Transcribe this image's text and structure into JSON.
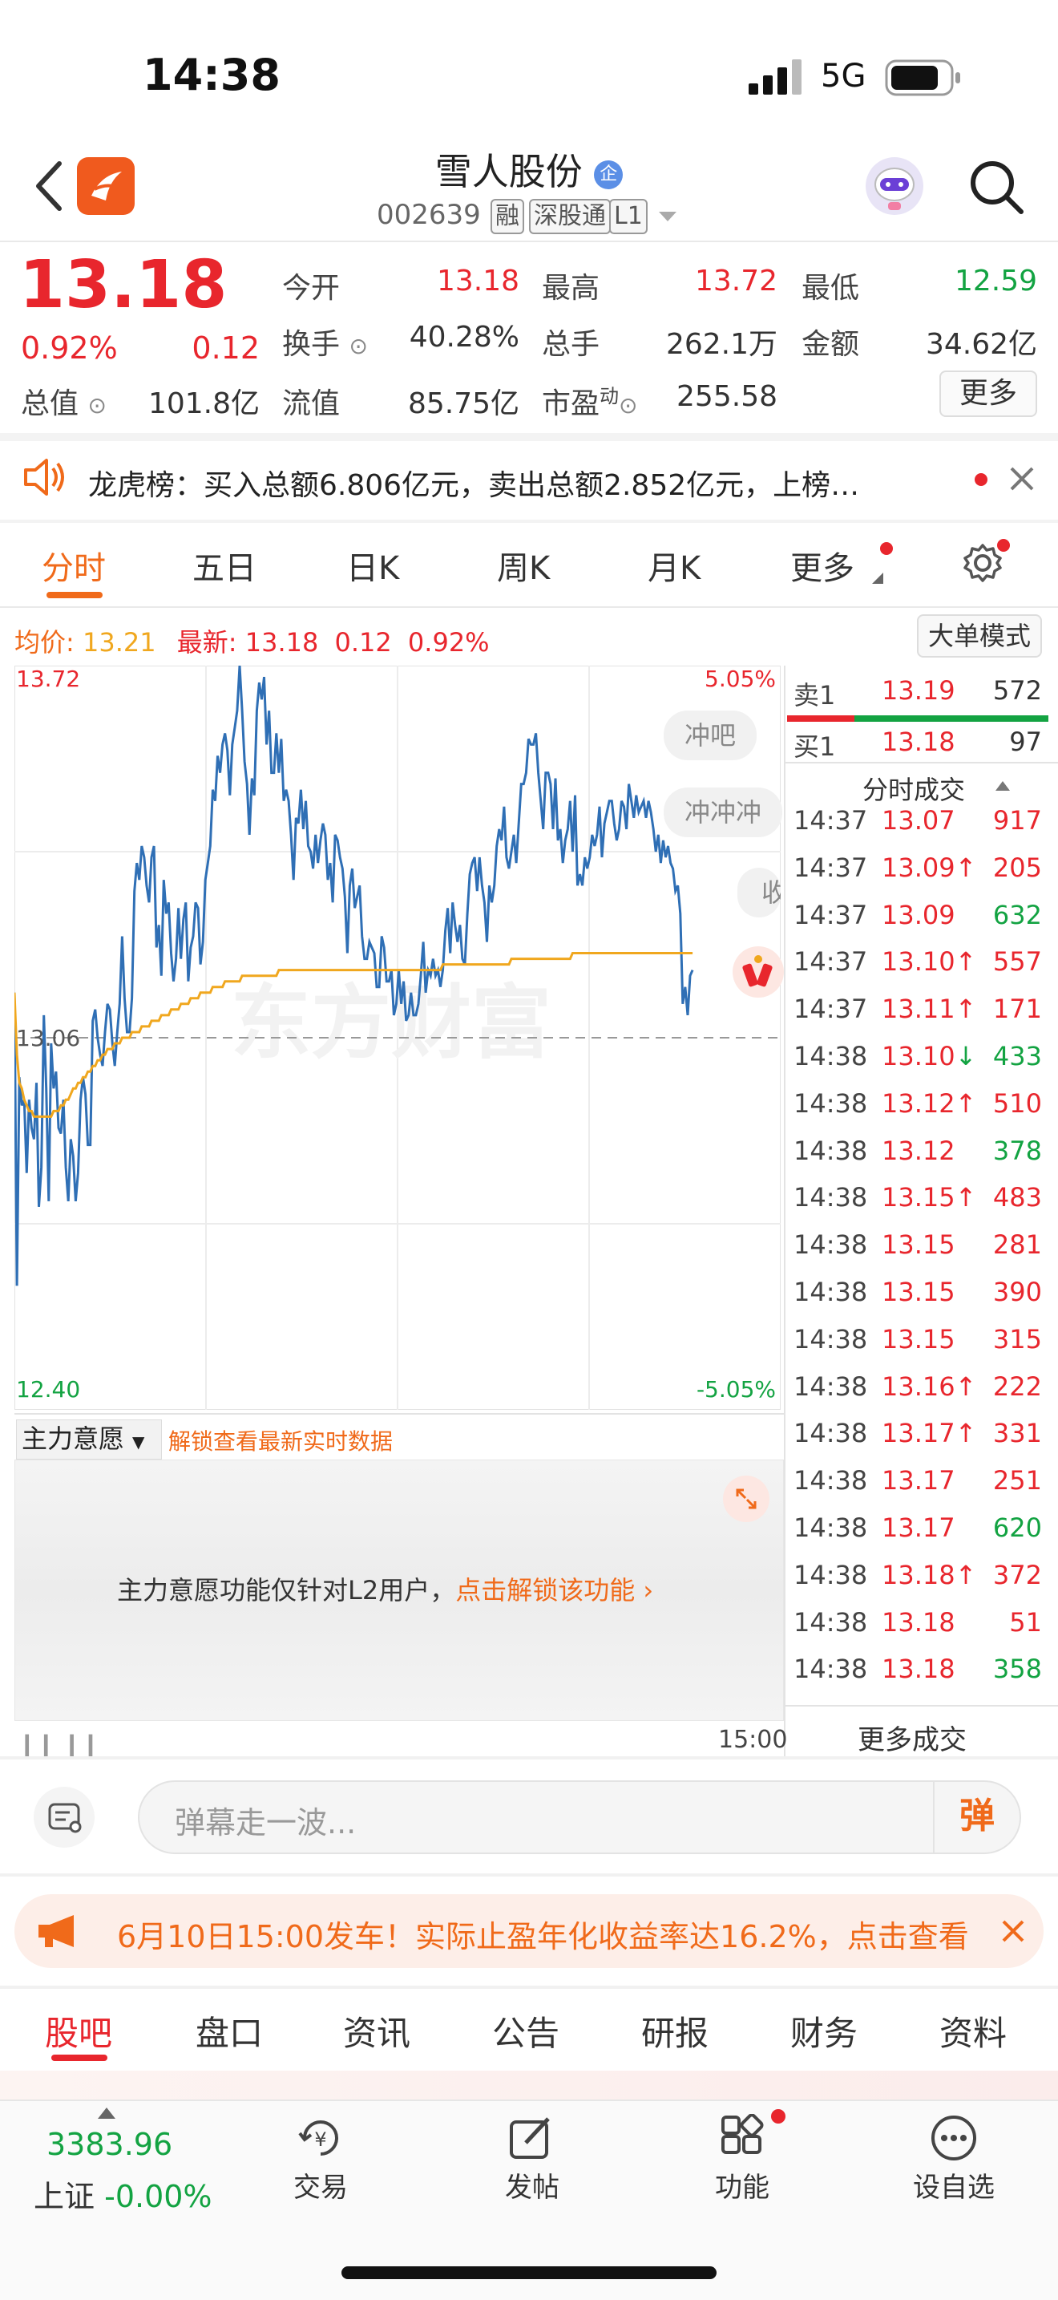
{
  "status": {
    "time": "14:38",
    "network": "5G"
  },
  "header": {
    "title": "雪人股份",
    "badge": "企",
    "code": "002639",
    "tags": [
      "融",
      "深股通",
      "L1"
    ]
  },
  "quote": {
    "price": "13.18",
    "change_pct": "0.92%",
    "change": "0.12",
    "open_label": "今开",
    "open": "13.18",
    "high_label": "最高",
    "high": "13.72",
    "low_label": "最低",
    "low": "12.59",
    "turnover_label": "换手",
    "turnover": "40.28%",
    "volume_label": "总手",
    "volume": "262.1万",
    "amount_label": "金额",
    "amount": "34.62亿",
    "mktcap_label": "总值",
    "mktcap": "101.8亿",
    "float_label": "流值",
    "float": "85.75亿",
    "pe_label": "市盈",
    "pe_sup": "动",
    "pe": "255.58",
    "more_button": "更多"
  },
  "notice": {
    "text": "龙虎榜：买入总额6.806亿元，卖出总额2.852亿元，上榜…"
  },
  "tabs": [
    "分时",
    "五日",
    "日K",
    "周K",
    "月K",
    "更多"
  ],
  "chart_info": {
    "avg_label": "均价:",
    "avg": "13.21",
    "latest_label": "最新:",
    "latest": "13.18",
    "latest_change": "0.12",
    "latest_pct": "0.92%",
    "mode_button": "大单模式",
    "y_max": "13.72",
    "y_mid": "13.06",
    "y_min": "12.40",
    "pct_max": "5.05%",
    "pct_min": "-5.05%",
    "end_time": "15:00",
    "bullet1": "冲吧",
    "bullet2": "冲冲冲",
    "bullet3": "收",
    "watermark": "东方财富"
  },
  "chart_data": {
    "type": "line",
    "y_range": [
      12.4,
      13.72
    ],
    "series": [
      {
        "name": "最新",
        "color": "#2f6fb5",
        "values": [
          13.14,
          12.62,
          12.99,
          12.94,
          12.95,
          12.82,
          12.95,
          12.9,
          12.88,
          12.98,
          12.76,
          12.83,
          13.1,
          12.97,
          12.77,
          13.05,
          12.97,
          13.0,
          12.9,
          12.89,
          12.95,
          12.83,
          12.77,
          12.88,
          12.85,
          12.77,
          12.82,
          12.95,
          12.99,
          12.96,
          12.87,
          12.87,
          13.09,
          13.11,
          13.06,
          13.03,
          13.01,
          13.07,
          13.12,
          13.11,
          13.05,
          13.01,
          13.07,
          13.12,
          13.24,
          13.13,
          13.07,
          13.07,
          13.13,
          13.32,
          13.37,
          13.34,
          13.4,
          13.38,
          13.33,
          13.3,
          13.38,
          13.4,
          13.22,
          13.26,
          13.17,
          13.34,
          13.28,
          13.3,
          13.21,
          13.16,
          13.2,
          13.29,
          13.2,
          13.27,
          13.3,
          13.16,
          13.22,
          13.24,
          13.3,
          13.29,
          13.19,
          13.23,
          13.34,
          13.37,
          13.4,
          13.5,
          13.48,
          13.56,
          13.53,
          13.58,
          13.6,
          13.57,
          13.49,
          13.58,
          13.61,
          13.64,
          13.72,
          13.64,
          13.55,
          13.51,
          13.42,
          13.52,
          13.49,
          13.64,
          13.69,
          13.66,
          13.7,
          13.58,
          13.64,
          13.53,
          13.53,
          13.6,
          13.53,
          13.59,
          13.48,
          13.5,
          13.48,
          13.42,
          13.34,
          13.45,
          13.44,
          13.5,
          13.43,
          13.48,
          13.4,
          13.39,
          13.36,
          13.42,
          13.37,
          13.41,
          13.44,
          13.42,
          13.34,
          13.37,
          13.3,
          13.42,
          13.41,
          13.38,
          13.36,
          13.31,
          13.21,
          13.33,
          13.36,
          13.29,
          13.31,
          13.33,
          13.24,
          13.2,
          13.2,
          13.23,
          13.22,
          13.21,
          13.15,
          13.15,
          13.24,
          13.22,
          13.16,
          13.16,
          13.18,
          13.1,
          13.12,
          13.18,
          13.12,
          13.16,
          13.09,
          13.1,
          13.14,
          13.1,
          13.1,
          13.12,
          13.17,
          13.23,
          13.14,
          13.18,
          13.17,
          13.2,
          13.17,
          13.18,
          13.15,
          13.18,
          13.25,
          13.29,
          13.21,
          13.3,
          13.26,
          13.23,
          13.26,
          13.2,
          13.19,
          13.28,
          13.35,
          13.37,
          13.38,
          13.32,
          13.38,
          13.33,
          13.3,
          13.23,
          13.33,
          13.3,
          13.33,
          13.4,
          13.43,
          13.41,
          13.47,
          13.38,
          13.36,
          13.39,
          13.42,
          13.37,
          13.44,
          13.51,
          13.51,
          13.53,
          13.59,
          13.58,
          13.58,
          13.6,
          13.53,
          13.48,
          13.43,
          13.53,
          13.53,
          13.51,
          13.43,
          13.52,
          13.41,
          13.43,
          13.37,
          13.41,
          13.43,
          13.48,
          13.39,
          13.49,
          13.33,
          13.35,
          13.33,
          13.38,
          13.36,
          13.38,
          13.42,
          13.4,
          13.42,
          13.47,
          13.38,
          13.44,
          13.46,
          13.48,
          13.48,
          13.44,
          13.41,
          13.43,
          13.48,
          13.47,
          13.43,
          13.51,
          13.48,
          13.45,
          13.49,
          13.46,
          13.47,
          13.48,
          13.45,
          13.48,
          13.46,
          13.43,
          13.39,
          13.42,
          13.37,
          13.41,
          13.38,
          13.4,
          13.37,
          13.36,
          13.32,
          13.33,
          13.28,
          13.12,
          13.15,
          13.1,
          13.17,
          13.18
        ]
      },
      {
        "name": "均价",
        "color": "#f0a71e",
        "values": [
          13.14,
          13.03,
          12.98,
          12.97,
          12.95,
          12.94,
          12.93,
          12.93,
          12.92,
          12.92,
          12.92,
          12.92,
          12.92,
          12.92,
          12.92,
          12.92,
          12.93,
          12.93,
          12.93,
          12.94,
          12.94,
          12.95,
          12.95,
          12.96,
          12.97,
          12.97,
          12.98,
          12.98,
          12.99,
          12.99,
          13.0,
          13.0,
          13.01,
          13.01,
          13.02,
          13.02,
          13.03,
          13.03,
          13.04,
          13.04,
          13.04,
          13.05,
          13.05,
          13.05,
          13.06,
          13.06,
          13.06,
          13.06,
          13.07,
          13.07,
          13.07,
          13.07,
          13.08,
          13.08,
          13.08,
          13.08,
          13.09,
          13.09,
          13.09,
          13.09,
          13.1,
          13.1,
          13.1,
          13.1,
          13.11,
          13.11,
          13.11,
          13.11,
          13.12,
          13.12,
          13.12,
          13.12,
          13.13,
          13.13,
          13.13,
          13.13,
          13.14,
          13.14,
          13.14,
          13.14,
          13.14,
          13.15,
          13.15,
          13.15,
          13.15,
          13.15,
          13.16,
          13.16,
          13.16,
          13.16,
          13.16,
          13.16,
          13.16,
          13.17,
          13.17,
          13.17,
          13.17,
          13.17,
          13.17,
          13.17,
          13.17,
          13.17,
          13.17,
          13.17,
          13.17,
          13.17,
          13.17,
          13.17,
          13.18,
          13.18,
          13.18,
          13.18,
          13.18,
          13.18,
          13.18,
          13.18,
          13.18,
          13.18,
          13.18,
          13.18,
          13.18,
          13.18,
          13.18,
          13.18,
          13.18,
          13.18,
          13.18,
          13.18,
          13.18,
          13.18,
          13.18,
          13.18,
          13.18,
          13.18,
          13.18,
          13.18,
          13.18,
          13.18,
          13.18,
          13.18,
          13.18,
          13.18,
          13.18,
          13.18,
          13.18,
          13.18,
          13.18,
          13.18,
          13.18,
          13.18,
          13.18,
          13.18,
          13.18,
          13.18,
          13.18,
          13.18,
          13.18,
          13.18,
          13.18,
          13.18,
          13.18,
          13.18,
          13.18,
          13.18,
          13.18,
          13.18,
          13.18,
          13.18,
          13.18,
          13.18,
          13.18,
          13.18,
          13.18,
          13.18,
          13.18,
          13.19,
          13.19,
          13.19,
          13.19,
          13.19,
          13.19,
          13.19,
          13.19,
          13.19,
          13.19,
          13.19,
          13.19,
          13.19,
          13.19,
          13.19,
          13.19,
          13.19,
          13.19,
          13.19,
          13.19,
          13.19,
          13.19,
          13.19,
          13.19,
          13.19,
          13.19,
          13.19,
          13.19,
          13.2,
          13.2,
          13.2,
          13.2,
          13.2,
          13.2,
          13.2,
          13.2,
          13.2,
          13.2,
          13.2,
          13.2,
          13.2,
          13.2,
          13.2,
          13.2,
          13.2,
          13.2,
          13.2,
          13.2,
          13.2,
          13.2,
          13.2,
          13.2,
          13.2,
          13.21,
          13.21,
          13.21,
          13.21,
          13.21,
          13.21,
          13.21,
          13.21,
          13.21,
          13.21,
          13.21,
          13.21,
          13.21,
          13.21,
          13.21,
          13.21,
          13.21,
          13.21,
          13.21,
          13.21,
          13.21,
          13.21,
          13.21,
          13.21,
          13.21,
          13.21,
          13.21,
          13.21,
          13.21,
          13.21,
          13.21,
          13.21,
          13.21,
          13.21,
          13.21,
          13.21,
          13.21,
          13.21,
          13.21,
          13.21,
          13.21,
          13.21,
          13.21,
          13.21,
          13.21,
          13.21,
          13.21,
          13.21,
          13.21,
          13.21
        ]
      }
    ]
  },
  "orderbook": {
    "sell_label": "卖1",
    "sell_price": "13.19",
    "sell_vol": "572",
    "buy_label": "买1",
    "buy_price": "13.18",
    "buy_vol": "97",
    "ticks_title": "分时成交",
    "ticks": [
      {
        "t": "14:37",
        "p": "13.07",
        "v": "917",
        "dir": "",
        "pc": "red",
        "vc": "red"
      },
      {
        "t": "14:37",
        "p": "13.09",
        "v": "205",
        "dir": "↑",
        "pc": "red",
        "vc": "red"
      },
      {
        "t": "14:37",
        "p": "13.09",
        "v": "632",
        "dir": "",
        "pc": "red",
        "vc": "green"
      },
      {
        "t": "14:37",
        "p": "13.10",
        "v": "557",
        "dir": "↑",
        "pc": "red",
        "vc": "red"
      },
      {
        "t": "14:37",
        "p": "13.11",
        "v": "171",
        "dir": "↑",
        "pc": "red",
        "vc": "red"
      },
      {
        "t": "14:38",
        "p": "13.10",
        "v": "433",
        "dir": "↓",
        "pc": "red",
        "vc": "green"
      },
      {
        "t": "14:38",
        "p": "13.12",
        "v": "510",
        "dir": "↑",
        "pc": "red",
        "vc": "red"
      },
      {
        "t": "14:38",
        "p": "13.12",
        "v": "378",
        "dir": "",
        "pc": "red",
        "vc": "green"
      },
      {
        "t": "14:38",
        "p": "13.15",
        "v": "483",
        "dir": "↑",
        "pc": "red",
        "vc": "red"
      },
      {
        "t": "14:38",
        "p": "13.15",
        "v": "281",
        "dir": "",
        "pc": "red",
        "vc": "red"
      },
      {
        "t": "14:38",
        "p": "13.15",
        "v": "390",
        "dir": "",
        "pc": "red",
        "vc": "red"
      },
      {
        "t": "14:38",
        "p": "13.15",
        "v": "315",
        "dir": "",
        "pc": "red",
        "vc": "red"
      },
      {
        "t": "14:38",
        "p": "13.16",
        "v": "222",
        "dir": "↑",
        "pc": "red",
        "vc": "red"
      },
      {
        "t": "14:38",
        "p": "13.17",
        "v": "331",
        "dir": "↑",
        "pc": "red",
        "vc": "red"
      },
      {
        "t": "14:38",
        "p": "13.17",
        "v": "251",
        "dir": "",
        "pc": "red",
        "vc": "red"
      },
      {
        "t": "14:38",
        "p": "13.17",
        "v": "620",
        "dir": "",
        "pc": "red",
        "vc": "green"
      },
      {
        "t": "14:38",
        "p": "13.18",
        "v": "372",
        "dir": "↑",
        "pc": "red",
        "vc": "red"
      },
      {
        "t": "14:38",
        "p": "13.18",
        "v": "51",
        "dir": "",
        "pc": "red",
        "vc": "red"
      },
      {
        "t": "14:38",
        "p": "13.18",
        "v": "358",
        "dir": "",
        "pc": "red",
        "vc": "green"
      }
    ],
    "more_label": "更多成交"
  },
  "main_force": {
    "select_label": "主力意愿",
    "unlock_link": "解锁查看最新实时数据",
    "msg": "主力意愿功能仅针对L2用户，",
    "msg_link": "点击解锁该功能"
  },
  "comment": {
    "placeholder": "弹幕走一波...",
    "send_label": "弹"
  },
  "banner": {
    "text": "6月10日15:00发车！实际止盈年化收益率达16.2%，点击查看"
  },
  "bottom_tabs": [
    "股吧",
    "盘口",
    "资讯",
    "公告",
    "研报",
    "财务",
    "资料"
  ],
  "nav": {
    "index_value": "3383.96",
    "index_name": "上证",
    "index_change": "-0.00%",
    "trade": "交易",
    "post": "发帖",
    "func": "功能",
    "watch": "设自选"
  },
  "colors": {
    "red": "#e8262d",
    "green": "#13a342",
    "orange": "#f06a1a",
    "blue_line": "#2f6fb5",
    "avg_line": "#f0a71e"
  }
}
